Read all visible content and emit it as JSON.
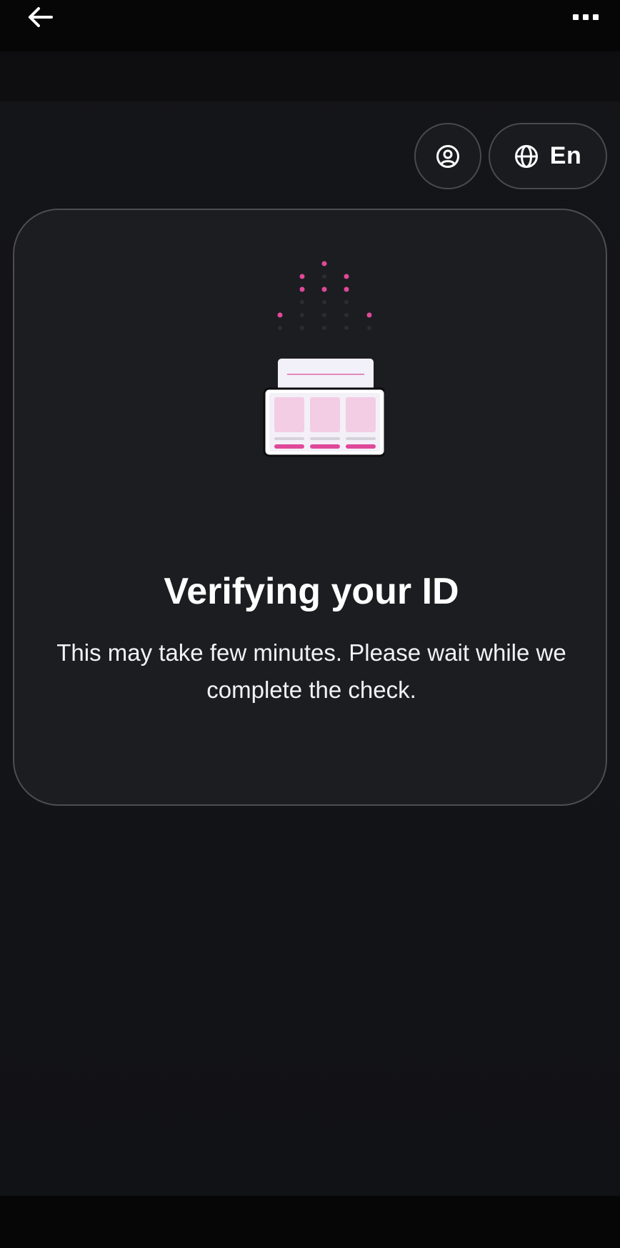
{
  "header": {
    "back_icon": "arrow-left-icon",
    "more_icon": "more-horizontal-icon"
  },
  "controls": {
    "profile_icon": "user-circle-icon",
    "language_icon": "globe-icon",
    "language_label": "En"
  },
  "status_card": {
    "illustration": "document-scan-illustration",
    "title": "Verifying your ID",
    "message": "This may take few minutes. Please wait while we complete the check."
  },
  "colors": {
    "accent": "#e0489a",
    "accent_light": "#f3cde4",
    "background": "#121317",
    "card": "#1c1d21",
    "border": "#4d4d52"
  }
}
